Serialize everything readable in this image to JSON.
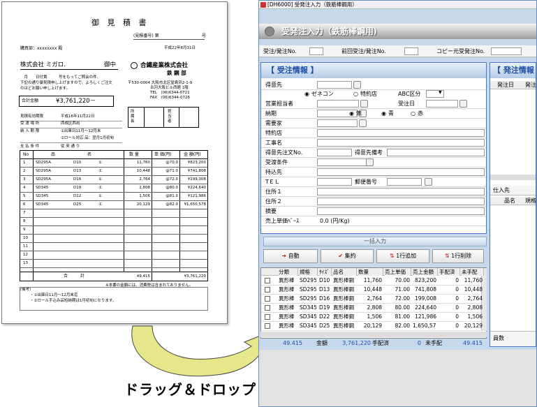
{
  "doc": {
    "title": "御 見 積 書",
    "doc_no_label": "(見積番号) 第",
    "doc_no_suffix": "号",
    "date": "平成22年8月31日",
    "buyer_label": "購買部：xxxxxxxx 殿",
    "customer": "株式会社 ミガロ.",
    "customer_suffix": "御中",
    "intro1": "　月　　日付貴　　　号をもってご照会の件、",
    "intro2": "下記の通り御見積申し上げますので、よろしくご注文",
    "intro3": "のほどお願い申し上げます。",
    "company_name": "合鐵産業株式会社",
    "company_dept": "鉄 鋼 部",
    "company_addr1": "〒530-0004 大阪市北区堂島浜2-1-9",
    "company_addr2": "古河大阪ビル西館 1階",
    "company_tel": "TEL　(06)6344-0721",
    "company_fax": "FAX　(06)6344-0726",
    "total_label": "合計金額",
    "total_value": "¥3,761,220－",
    "stamp_left": "所属長",
    "stamp_right": "担当者",
    "info": [
      {
        "label": "見積有効期限",
        "value": "平成16年11月22日"
      },
      {
        "label": "受 渡 場 所",
        "value": "西成区西出"
      },
      {
        "label": "納 入 期 限",
        "value": "①出庫日11月～12月末"
      },
      {
        "label": "",
        "value": "②ロール対応 品：翌月1月初旬"
      },
      {
        "label": "支 払 条 件",
        "value": "従 来 通 り"
      }
    ],
    "table_headers": [
      "No",
      "品",
      "名",
      "数 量",
      "単 価(円)",
      "金 額(円)"
    ],
    "rows": [
      {
        "no": "1",
        "name": "SD295A",
        "size": "D10",
        "mark": "①",
        "qty": "11,760",
        "price": "@70.0",
        "amount": "¥823,200"
      },
      {
        "no": "2",
        "name": "SD295A",
        "size": "D13",
        "mark": "①",
        "qty": "10,448",
        "price": "@71.0",
        "amount": "¥741,808"
      },
      {
        "no": "3",
        "name": "SD295A",
        "size": "D16",
        "mark": "①",
        "qty": "2,764",
        "price": "@72.0",
        "amount": "¥199,008"
      },
      {
        "no": "4",
        "name": "SD345",
        "size": "D19",
        "mark": "①",
        "qty": "2,808",
        "price": "@80.0",
        "amount": "¥224,640"
      },
      {
        "no": "5",
        "name": "SD345",
        "size": "D22",
        "mark": "①",
        "qty": "1,506",
        "price": "@81.0",
        "amount": "¥121,986"
      },
      {
        "no": "6",
        "name": "SD345",
        "size": "D25",
        "mark": "①",
        "qty": "20,129",
        "price": "@82.0",
        "amount": "¥1,650,578"
      },
      {
        "no": "7"
      },
      {
        "no": "8"
      },
      {
        "no": "9"
      },
      {
        "no": "10"
      },
      {
        "no": "11"
      },
      {
        "no": "12"
      },
      {
        "no": "13"
      }
    ],
    "sum_label": "合　　　計",
    "sum_qty": "49,415",
    "sum_amount": "¥3,761,220",
    "tax_note": "※本書の金額には、消費税は含まれておりません。",
    "remarks_label": "(備考)",
    "remark1": "・①出庫日11月～12月末迄",
    "remark2": "・②ロール手込み品短納期は1月初旬になります。"
  },
  "window": {
    "title": "[DH6000] 受発注入力（鉄筋棒鋼用）",
    "header": "受発注入力（鉄筋棒鋼用）",
    "top_labels": [
      "受注/発注No.",
      "前回受注/発注No.",
      "コピー元受発注No."
    ],
    "section_order": "【 受注情報 】",
    "section_purchase": "【 発注情報",
    "labels": {
      "customer": "得意先",
      "sales_rep": "営業担当者",
      "delivery": "納期",
      "demand": "需要家",
      "special": "特約店",
      "project": "工事名",
      "customer_order_no": "得意先注文No.",
      "customer_remarks": "得意先備考",
      "delivery_cond": "受渡条件",
      "destination": "持込先",
      "tel": "TＥＬ",
      "postal": "郵便番号",
      "addr1": "住所１",
      "addr2": "住所２",
      "summary": "摘要",
      "unit_price": "売上単価ﾍﾞｰｽ",
      "abc": "ABC区分",
      "order_date": "受注日"
    },
    "radio1": [
      "ゼネコン",
      "特約店"
    ],
    "radio2": [
      "無",
      "青",
      "赤"
    ],
    "unit_price_value": "0.0 (円/Kg)",
    "bulk_input": "一括入力",
    "buttons": [
      "自動",
      "集約",
      "1行追加",
      "1行削除"
    ],
    "grid_headers": [
      "分類",
      "規格",
      "ｻｲｽﾞ",
      "品名",
      "数量",
      "売上単価",
      "売上金額",
      "手配済",
      "未手配"
    ],
    "grid_rows": [
      [
        "異形棒",
        "SD295A",
        "D10",
        "異形棒鋼",
        "11,760",
        "70.00",
        "823,200",
        "0",
        "11,760"
      ],
      [
        "異形棒",
        "SD295A",
        "D13",
        "異形棒鋼",
        "10,448",
        "71.00",
        "741,808",
        "0",
        "10,448"
      ],
      [
        "異形棒",
        "SD295A",
        "D16",
        "異形棒鋼",
        "2,764",
        "72.00",
        "199,008",
        "0",
        "2,764"
      ],
      [
        "異形棒",
        "SD345",
        "D19",
        "異形棒鋼",
        "2,808",
        "80.00",
        "224,640",
        "0",
        "2,808"
      ],
      [
        "異形棒",
        "SD345",
        "D22",
        "異形棒鋼",
        "1,506",
        "81.00",
        "121,986",
        "0",
        "1,506"
      ],
      [
        "異形棒",
        "SD345",
        "D25",
        "異形棒鋼",
        "20,129",
        "82.00",
        "1,650,578",
        "0",
        "20,129"
      ]
    ],
    "footer": {
      "qty": "49.415",
      "amount_label": "金額",
      "amount": "3,761,220",
      "arranged_label": "手配済",
      "arranged": "0",
      "unarranged_label": "未手配",
      "unarranged": "49.415"
    },
    "right_headers": [
      "発注日",
      "発注"
    ],
    "right_supplier": "仕入先",
    "right_sub_headers": [
      "品名",
      "規格"
    ],
    "right_count_label": "員数"
  },
  "caption": "ドラッグ＆ドロップ",
  "colors": {
    "arrow_fill": "#e6e68a",
    "header_text": "#1c4ea8",
    "window_bg": "#c8d8ec"
  }
}
